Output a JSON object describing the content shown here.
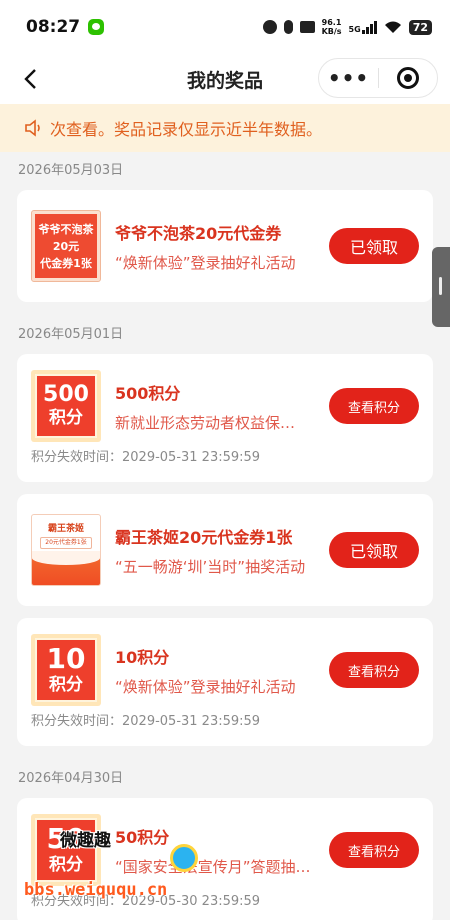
{
  "status_bar": {
    "time": "08:27",
    "net_speed_value": "96.1",
    "net_speed_unit": "KB/s",
    "network": "5G",
    "battery": "72"
  },
  "nav": {
    "title": "我的奖品",
    "more_label": "•••"
  },
  "notice": {
    "text": "次查看。奖品记录仅显示近半年数据。"
  },
  "groups": [
    {
      "date": "2026年05月03日",
      "items": [
        {
          "thumb_lines": [
            "爷爷不泡茶",
            "20元",
            "代金券1张"
          ],
          "title": "爷爷不泡茶20元代金券",
          "subtitle": "“焕新体验”登录抽好礼活动",
          "action": "已领取"
        }
      ]
    },
    {
      "date": "2026年05月01日",
      "items": [
        {
          "thumb_num": "500",
          "thumb_unit": "积分",
          "title": "500积分",
          "subtitle": "新就业形态劳动者权益保…",
          "action": "查看积分",
          "expiry": "积分失效时间：2029-05-31 23:59:59"
        },
        {
          "thumb_title": "霸王茶姬",
          "thumb_sub": "20元代金券1张",
          "title": "霸王茶姬20元代金券1张",
          "subtitle": "“五一畅游‘圳’当时”抽奖活动",
          "action": "已领取"
        },
        {
          "thumb_num": "10",
          "thumb_unit": "积分",
          "title": "10积分",
          "subtitle": "“焕新体验”登录抽好礼活动",
          "action": "查看积分",
          "expiry": "积分失效时间：2029-05-31 23:59:59"
        }
      ]
    },
    {
      "date": "2026年04月30日",
      "items": [
        {
          "thumb_num": "50",
          "thumb_unit": "积分",
          "title": "50积分",
          "subtitle": "“国家安全法宣传月”答题抽…",
          "action": "查看积分",
          "expiry": "积分失效时间：2029-05-30 23:59:59"
        }
      ]
    }
  ],
  "watermark": {
    "name": "微趣趣",
    "url": "bbs.weiququ.cn"
  },
  "colors": {
    "accent_red": "#e2231a",
    "notice_bg": "#fdf2dc",
    "notice_text": "#e0601f"
  }
}
